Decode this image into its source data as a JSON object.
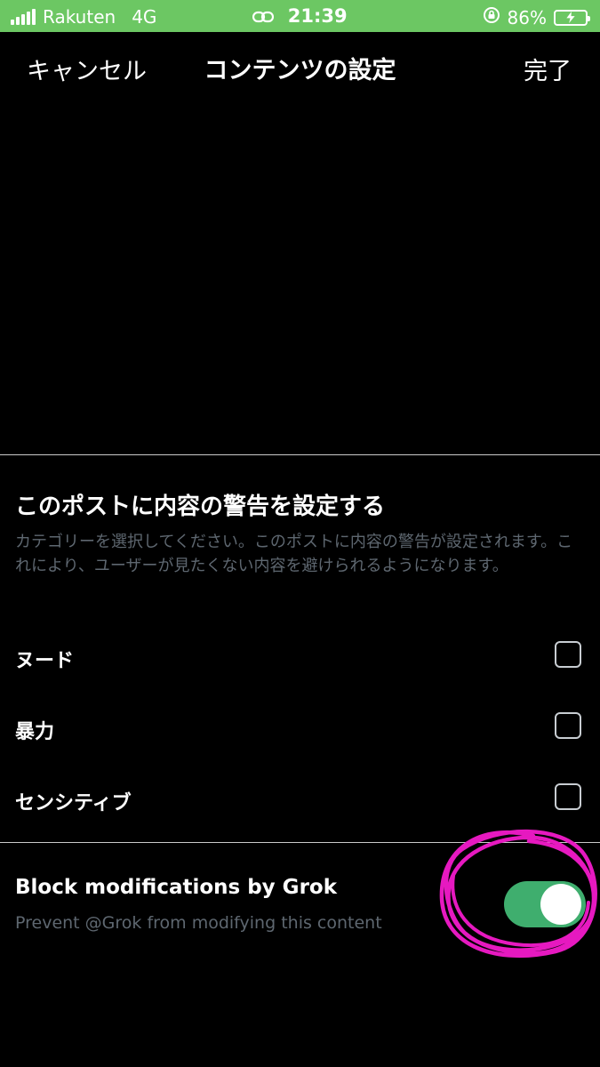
{
  "status_bar": {
    "carrier": "Rakuten",
    "network": "4G",
    "time": "21:39",
    "battery": "86%",
    "icons": [
      "signal-bars-icon",
      "link-icon",
      "rotation-lock-icon",
      "battery-charging-icon"
    ],
    "background_color": "#6cc763"
  },
  "nav": {
    "cancel_label": "キャンセル",
    "title": "コンテンツの設定",
    "done_label": "完了"
  },
  "warning_section": {
    "title": "このポストに内容の警告を設定する",
    "description": "カテゴリーを選択してください。このポストに内容の警告が設定されます。これにより、ユーザーが見たくない内容を避けられるようになります。",
    "options": [
      {
        "label": "ヌード",
        "checked": false
      },
      {
        "label": "暴力",
        "checked": false
      },
      {
        "label": "センシティブ",
        "checked": false
      }
    ]
  },
  "grok_section": {
    "title": "Block modifications by Grok",
    "description": "Prevent @Grok from modifying this content",
    "toggle_on": true,
    "toggle_color": "#3fae6e"
  },
  "annotation": {
    "type": "hand-drawn circle around toggle",
    "color": "#e619c0"
  }
}
